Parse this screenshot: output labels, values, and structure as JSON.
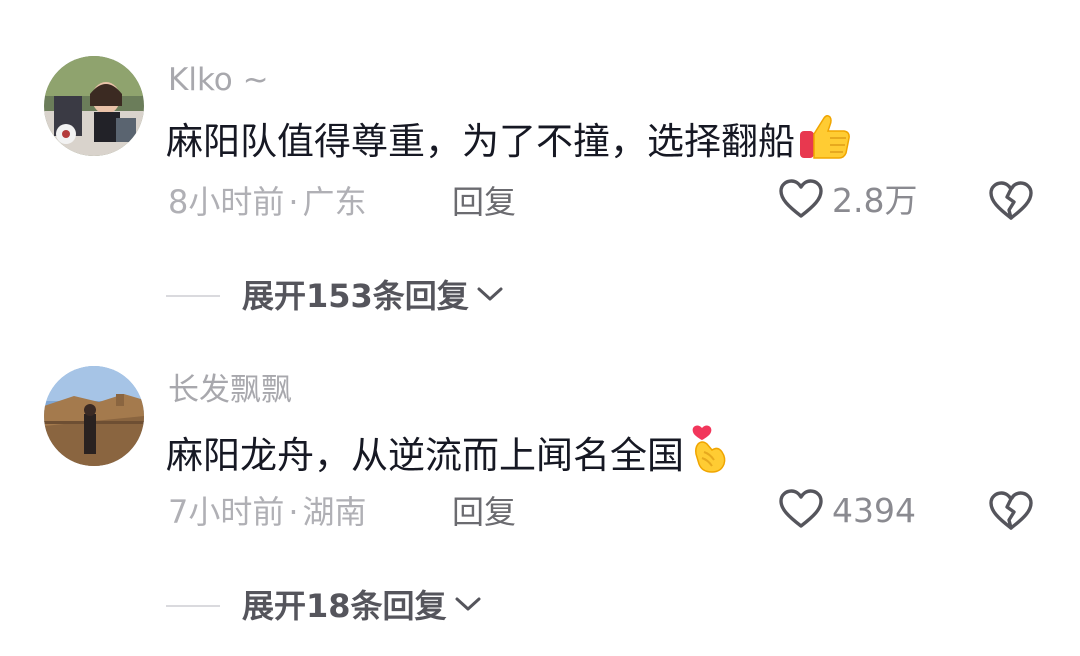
{
  "comments": [
    {
      "username": "Klko ~",
      "content": "麻阳队值得尊重，为了不撞，选择翻船",
      "emoji_icon": "thumbs-up-icon",
      "time": "8小时前",
      "location": "广东",
      "reply_label": "回复",
      "likes": "2.8万",
      "expand_label": "展开153条回复"
    },
    {
      "username": "长发飘飘",
      "content": "麻阳龙舟，从逆流而上闻名全国",
      "emoji_icon": "finger-heart-icon",
      "time": "7小时前",
      "location": "湖南",
      "reply_label": "回复",
      "likes": "4394",
      "expand_label": "展开18条回复"
    }
  ],
  "separator": "·",
  "icons": {
    "like": "heart-outline-icon",
    "dislike": "broken-heart-icon",
    "expand": "chevron-down-icon"
  },
  "colors": {
    "username": "#a8a8ad",
    "text": "#161823",
    "meta": "#b0b0b5",
    "reply": "#6b6b70",
    "expand": "#55555c"
  }
}
